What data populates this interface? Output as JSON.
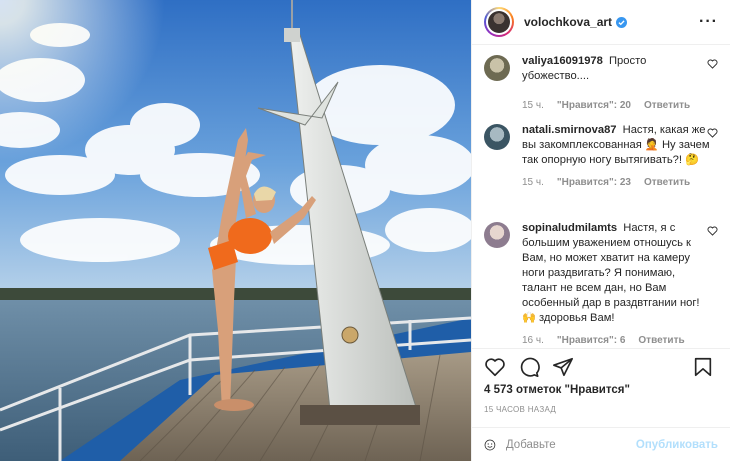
{
  "post": {
    "author": "volochkova_art",
    "verified": true,
    "more_icon": "more-horizontal-icon"
  },
  "comments": [
    {
      "username": "valiya16091978",
      "text": "Просто убожество....",
      "time": "15 ч.",
      "likes": "\"Нравится\": 20",
      "reply": "Ответить"
    },
    {
      "username": "natali.smirnova87",
      "text": "Настя, какая же вы закомплексованная 🤦 Ну зачем так опорную ногу вытягивать?! 🤔",
      "time": "15 ч.",
      "likes": "\"Нравится\": 23",
      "reply": "Ответить"
    },
    {
      "username": "sopinaludmilamts",
      "text": "Настя, я с большим уважением отношусь к Вам, но может хватит на камеру ноги раздвигать? Я понимаю, талант не всем дан, но Вам особенный дар в раздвтгании ног!🙌 здоровья Вам!",
      "time": "16 ч.",
      "likes": "\"Нравится\": 6",
      "reply": "Ответить"
    }
  ],
  "stats": {
    "likes_text": "4 573 отметок \"Нравится\"",
    "posted_ago": "15 ЧАСОВ НАЗАД"
  },
  "composer": {
    "placeholder": "Добавьте",
    "publish_label": "Опубликовать"
  },
  "colors": {
    "verified_blue": "#3897f0",
    "publish_disabled": "#b2dffc",
    "meta_gray": "#8e8e8e"
  }
}
